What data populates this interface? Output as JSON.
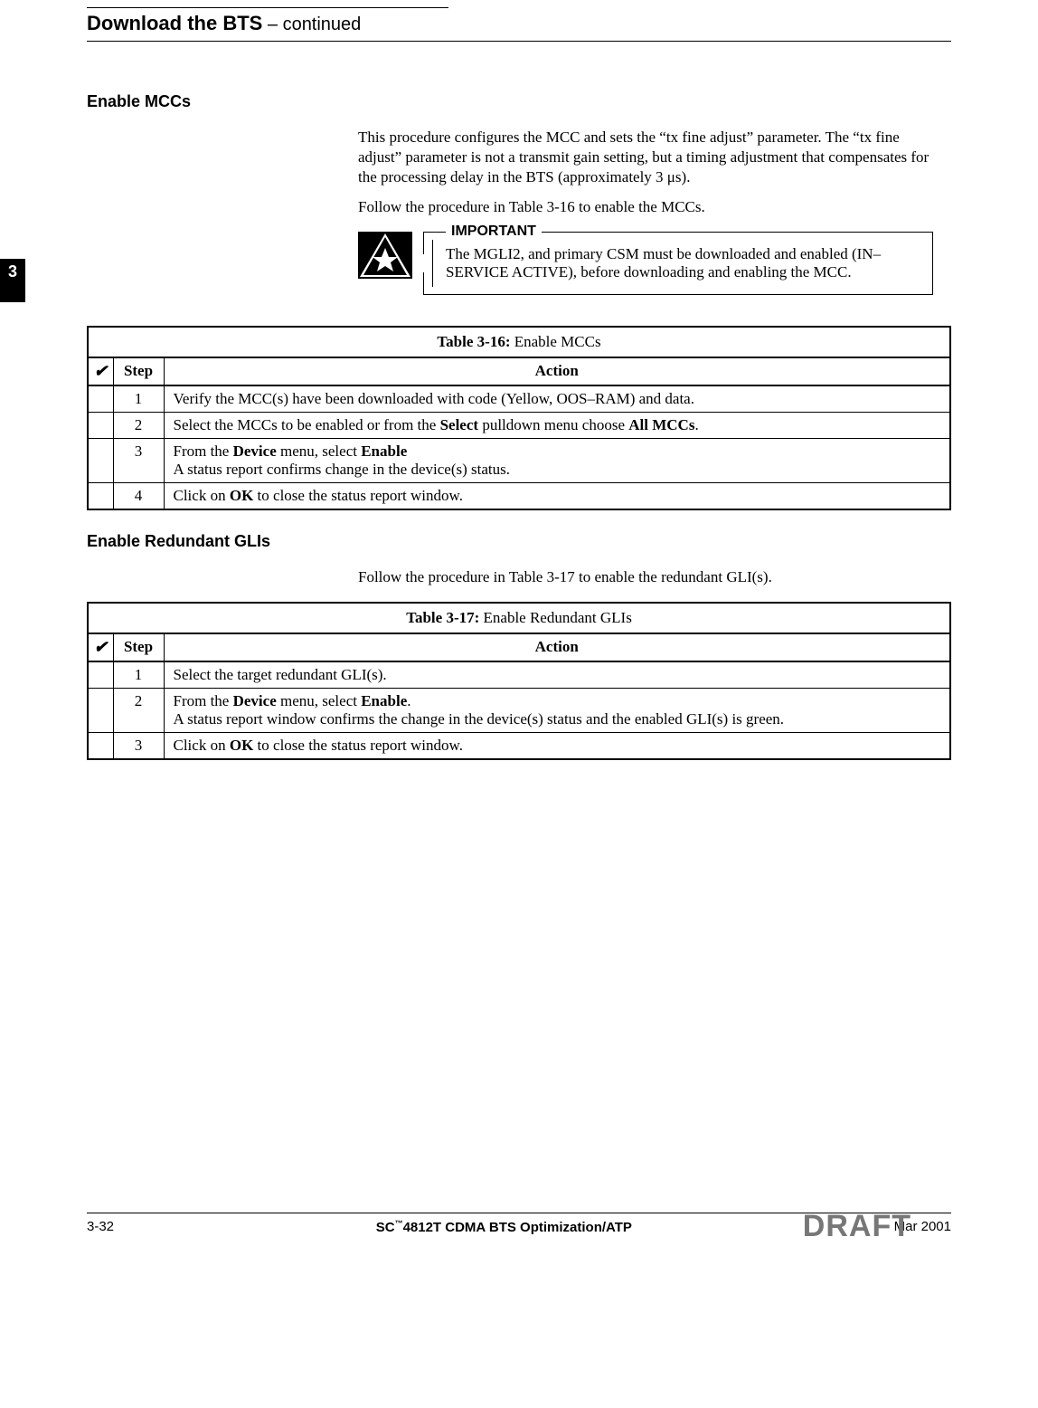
{
  "runningHead": {
    "title": "Download the BTS",
    "continued": " – continued"
  },
  "chapterFlag": "3",
  "section1": {
    "heading": "Enable MCCs",
    "para1": "This procedure configures the MCC and sets the “tx fine adjust” parameter. The “tx fine adjust” parameter is not a transmit gain setting, but a timing adjustment that compensates for the processing delay in the BTS (approximately 3 μs).",
    "para2": "Follow the procedure in Table 3-16 to enable the MCCs."
  },
  "important": {
    "label": "IMPORTANT",
    "text": "The MGLI2, and primary CSM must be downloaded and enabled (IN–SERVICE ACTIVE), before downloading and enabling the MCC."
  },
  "table1": {
    "titlePrefix": "Table 3-16:",
    "titleText": " Enable MCCs",
    "headers": {
      "check": "✔",
      "step": "Step",
      "action": "Action"
    },
    "rows": [
      {
        "step": "1",
        "action": "Verify the MCC(s) have been downloaded with code (Yellow, OOS–RAM) and data."
      },
      {
        "step": "2",
        "actionPre": "Select the MCCs to be enabled or from the ",
        "actionB1": "Select",
        "actionMid": " pulldown menu choose ",
        "actionB2": "All MCCs",
        "actionPost": "."
      },
      {
        "step": "3",
        "line1Pre": "From the ",
        "line1B1": "Device",
        "line1Mid": " menu, select ",
        "line1B2": "Enable",
        "line2": "A status report confirms change in the device(s) status."
      },
      {
        "step": "4",
        "actionPre": "Click on ",
        "actionB1": "OK",
        "actionPost": " to close the status report window."
      }
    ]
  },
  "section2": {
    "heading": "Enable Redundant GLIs",
    "para1": "Follow the procedure in Table 3-17 to enable the redundant GLI(s)."
  },
  "table2": {
    "titlePrefix": "Table 3-17:",
    "titleText": " Enable Redundant GLIs",
    "headers": {
      "check": "✔",
      "step": "Step",
      "action": "Action"
    },
    "rows": [
      {
        "step": "1",
        "action": "Select the target redundant GLI(s)."
      },
      {
        "step": "2",
        "line1Pre": "From the ",
        "line1B1": "Device",
        "line1Mid": " menu, select ",
        "line1B2": "Enable",
        "line1Post": ".",
        "line2": "A status report window confirms the change in the device(s) status and the enabled GLI(s) is green."
      },
      {
        "step": "3",
        "actionPre": "Click on ",
        "actionB1": "OK",
        "actionPost": " to close the status report window."
      }
    ]
  },
  "footer": {
    "pageNum": "3-32",
    "centerPre": "SC",
    "centerTM": "™",
    "centerPost": "4812T CDMA BTS Optimization/ATP",
    "date": "Mar 2001",
    "draft": "DRAFT"
  }
}
